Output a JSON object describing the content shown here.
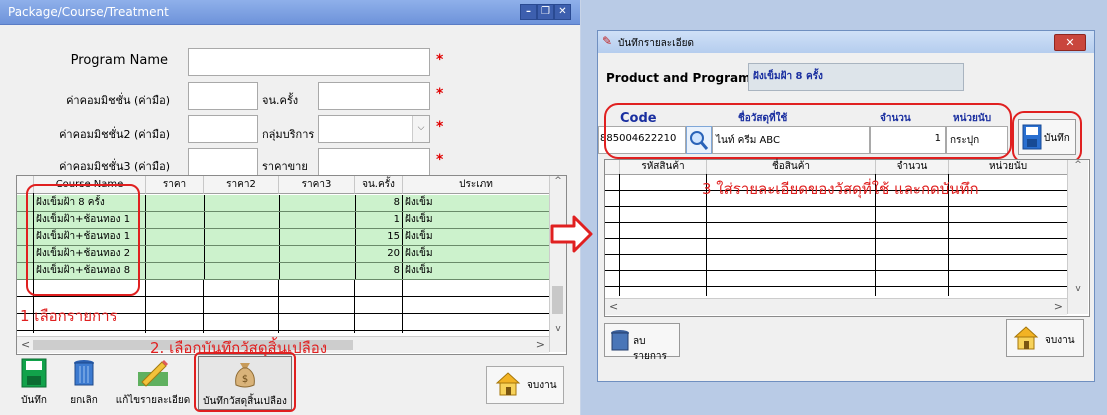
{
  "left": {
    "title": "Package/Course/Treatment",
    "fields": {
      "program_name": "Program Name",
      "commission1": "ค่าคอมมิชชั่น (ค่ามือ)",
      "count": "จน.ครั้ง",
      "commission2": "ค่าคอมมิชชั่น2 (ค่ามือ)",
      "service_group": "กลุ่มบริการ",
      "commission3": "ค่าคอมมิชชั่น3 (ค่ามือ)",
      "price": "ราคาขาย"
    },
    "grid": {
      "headers": [
        "Course Name",
        "ราคา",
        "ราคา2",
        "ราคา3",
        "จน.ครั้ง",
        "ประเภท"
      ],
      "rows": [
        {
          "name": "ฝังเข็มฝ้า 8 ครั้ง",
          "count": "8",
          "type": "ฝังเข็ม"
        },
        {
          "name": "ฝังเข็มฝ้า+ช้อนทอง 1",
          "count": "1",
          "type": "ฝังเข็ม"
        },
        {
          "name": "ฝังเข็มฝ้า+ช้อนทอง 1",
          "count": "15",
          "type": "ฝังเข็ม"
        },
        {
          "name": "ฝังเข็มฝ้า+ช้อนทอง 2",
          "count": "20",
          "type": "ฝังเข็ม"
        },
        {
          "name": "ฝังเข็มฝ้า+ช้อนทอง 8",
          "count": "8",
          "type": "ฝังเข็ม"
        }
      ]
    },
    "toolbar": {
      "save": "บันทึก",
      "cancel": "ยกเลิก",
      "edit": "แก้ไขรายละเอียด",
      "record_materials": "บันทึกวัสดุสิ้นเปลือง",
      "close": "จบงาน"
    },
    "annotations": {
      "step1": "1 เลือกรายการ",
      "step2": "2. เลือกบันทึกวัสดุสิ้นเปลือง"
    }
  },
  "right": {
    "title": "บันทึกรายละเอียด",
    "product_label": "Product and Program",
    "product_value": "ฝังเข็มฝ้า 8 ครั้ง",
    "headers": [
      "Code",
      "ชื่อวัสดุที่ใช้",
      "จำนวน",
      "หน่วยนับ"
    ],
    "entry": {
      "code": "885004622210",
      "name": "ไนท์ ครีม ABC",
      "qty": "1",
      "unit": "กระปุก"
    },
    "save_label": "บันทึก",
    "grid_headers": [
      "รหัสสินค้า",
      "ชื่อสินค้า",
      "จำนวน",
      "หน่วยนับ"
    ],
    "annotation": "3 ใส่รายละเอียดของวัสดุที่ใช้  และกดบันทึก",
    "delete_label": "ลบรายการ",
    "close_label": "จบงาน"
  },
  "colors": {
    "annotation_red": "#e02020",
    "grid_row_green": "#ccf2cc",
    "title_blue": "#6e93da"
  }
}
